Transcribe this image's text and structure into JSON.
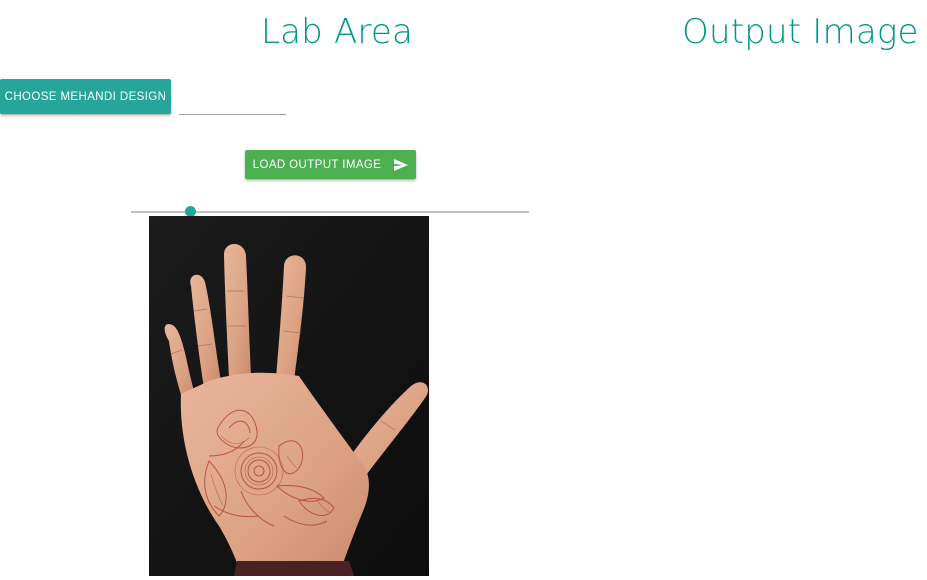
{
  "headings": {
    "lab_area": "Lab Area",
    "output_image": "Output Image"
  },
  "buttons": {
    "choose_design": "CHOOSE MEHANDI DESIGN",
    "load_output": "LOAD OUTPUT IMAGE",
    "load_output_icon": "send-icon"
  },
  "file_input": {
    "value": "",
    "placeholder": ""
  },
  "slider": {
    "value": 0.15
  },
  "image": {
    "subject": "hand-with-mehandi-design"
  },
  "colors": {
    "teal_heading": "#009688",
    "choose_button": "#26a69a",
    "load_button": "#4caf50",
    "slider_thumb": "#26a69a"
  }
}
